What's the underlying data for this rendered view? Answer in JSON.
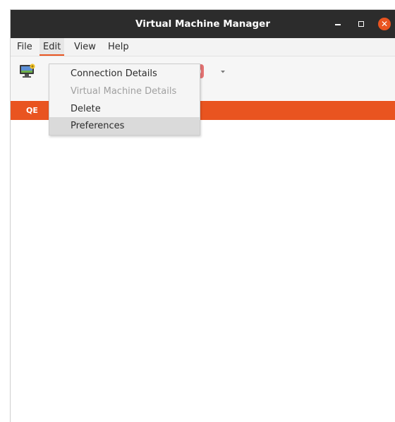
{
  "window": {
    "title": "Virtual Machine Manager",
    "close_glyph": "✕"
  },
  "menubar": {
    "items": [
      {
        "label": "File"
      },
      {
        "label": "Edit"
      },
      {
        "label": "View"
      },
      {
        "label": "Help"
      }
    ],
    "active": "Edit"
  },
  "edit_menu": {
    "items": [
      {
        "label": "Connection Details",
        "enabled": true
      },
      {
        "label": "Virtual Machine Details",
        "enabled": false
      },
      {
        "label": "Delete",
        "enabled": true
      },
      {
        "label": "Preferences",
        "enabled": true,
        "highlighted": true
      }
    ]
  },
  "section": {
    "label": "QE"
  },
  "icons": {
    "new_vm": "monitor-icon",
    "shutdown": "power-icon",
    "shutdown_menu": "chevron-down-icon"
  },
  "colors": {
    "titlebar": "#2c2c2c",
    "accent": "#e95420",
    "power": "#e57373"
  }
}
